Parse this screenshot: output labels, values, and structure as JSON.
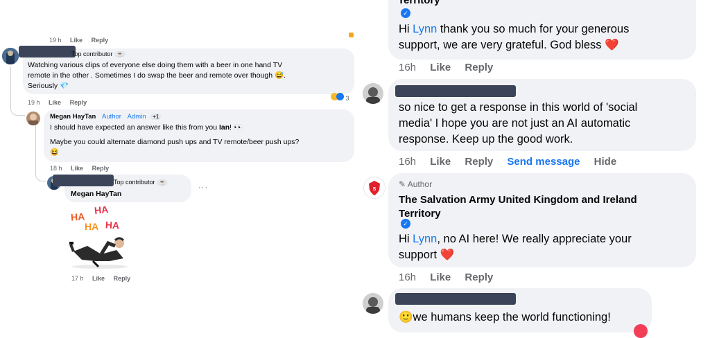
{
  "left": {
    "top_meta": {
      "time": "19 h",
      "like": "Like",
      "reply": "Reply"
    },
    "comment1": {
      "badge": "Top contributor",
      "lines": [
        "Watching various clips of everyone else doing them with a beer in one hand TV",
        "remote in the other . Sometimes I do swap the beer and remote over though 😅.",
        "Seriously 💎"
      ],
      "reactions_count": "3",
      "meta": {
        "time": "19 h",
        "like": "Like",
        "reply": "Reply"
      }
    },
    "comment2": {
      "author": "Megan HayTan",
      "author_tag": "Author",
      "admin_tag": "Admin",
      "plus": "+1",
      "line1_prefix": "I should have expected an answer like this from you ",
      "line1_name": "Ian",
      "line1_suffix": "! 👀",
      "line2": "Maybe you could alternate diamond push ups and TV remote/beer push ups?",
      "line3": "😆",
      "meta": {
        "time": "18 h",
        "like": "Like",
        "reply": "Reply"
      }
    },
    "comment3": {
      "badge": "Top contributor",
      "mention": "Megan HayTan",
      "more": "···",
      "sticker_text": [
        "HA",
        "HA",
        "HA",
        "HA"
      ],
      "meta": {
        "time": "17 h",
        "like": "Like",
        "reply": "Reply"
      }
    }
  },
  "right": {
    "reply1": {
      "cut_name": "Territory",
      "text_prefix": "Hi ",
      "name": "Lynn",
      "text_line1": " thank you so much for your generous",
      "text_line2": "support, we are very grateful. God bless ❤️",
      "meta": {
        "time": "16h",
        "like": "Like",
        "reply": "Reply"
      }
    },
    "comment2": {
      "lines": [
        "so nice to get a response in this world of 'social",
        "media' I hope you are not just an AI automatic",
        "response. Keep up the good work."
      ],
      "meta": {
        "time": "16h",
        "like": "Like",
        "reply": "Reply",
        "send_message": "Send message",
        "hide": "Hide"
      }
    },
    "reply3": {
      "author_label": "Author",
      "page_name_line1": "The Salvation Army United Kingdom and Ireland",
      "page_name_line2": "Territory",
      "text_prefix": "Hi ",
      "name": "Lynn",
      "text_line1": ", no AI here! We really appreciate your",
      "text_line2": "support ❤️",
      "meta": {
        "time": "16h",
        "like": "Like",
        "reply": "Reply"
      }
    },
    "comment4": {
      "text": "🙂we humans keep the world functioning!"
    }
  },
  "colors": {
    "bubble": "#f0f2f5",
    "link": "#1877f2",
    "redaction": "#3b4458",
    "salvation_red": "#e0202a"
  }
}
